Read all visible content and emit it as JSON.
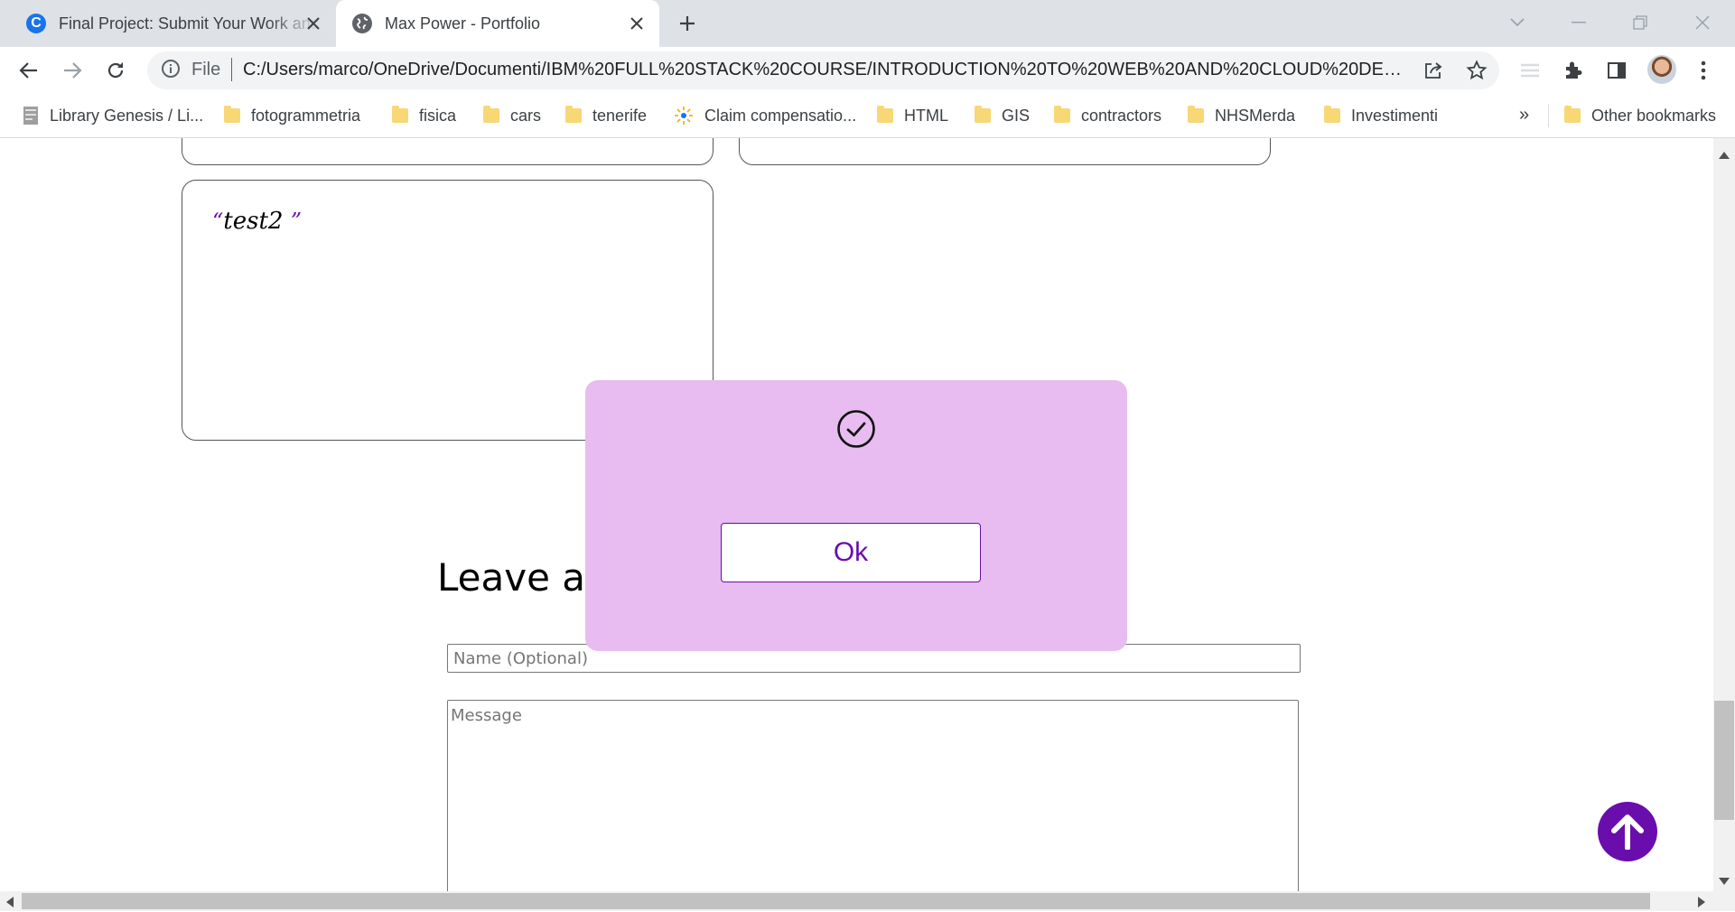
{
  "tabs": [
    {
      "title": "Final Project: Submit Your Work and",
      "favicon": "coursera-icon",
      "favicon_letter": "C",
      "active": false
    },
    {
      "title": "Max Power - Portfolio",
      "favicon": "globe-icon",
      "active": true
    }
  ],
  "toolbar": {
    "protocol_label": "File",
    "url": "C:/Users/marco/OneDrive/Documenti/IBM%20FULL%20STACK%20COURSE/INTRODUCTION%20TO%20WEB%20AND%20CLOUD%20DEV..."
  },
  "bookmarks": [
    {
      "label": "Library Genesis / Li...",
      "icon": "book-icon"
    },
    {
      "label": "fotogrammetria",
      "icon": "folder-icon"
    },
    {
      "label": "fisica",
      "icon": "folder-icon"
    },
    {
      "label": "cars",
      "icon": "folder-icon"
    },
    {
      "label": "tenerife",
      "icon": "folder-icon"
    },
    {
      "label": "Claim compensatio...",
      "icon": "plane-icon"
    },
    {
      "label": "HTML",
      "icon": "folder-icon"
    },
    {
      "label": "GIS",
      "icon": "folder-icon"
    },
    {
      "label": "contractors",
      "icon": "folder-icon"
    },
    {
      "label": "NHSMerda",
      "icon": "folder-icon"
    },
    {
      "label": "Investimenti",
      "icon": "folder-icon"
    }
  ],
  "bookmarks_more": "»",
  "other_bookmarks": "Other bookmarks",
  "page": {
    "testimonial_text": "test2",
    "quote_open": "“",
    "quote_close": "”",
    "leave_heading": "Leave a",
    "name_placeholder": "Name (Optional)",
    "message_placeholder": "Message"
  },
  "modal": {
    "icon": "check-circle-icon",
    "ok_label": "Ok"
  },
  "colors": {
    "accent": "#6a0dad",
    "modal_bg": "#e8bcf0"
  }
}
